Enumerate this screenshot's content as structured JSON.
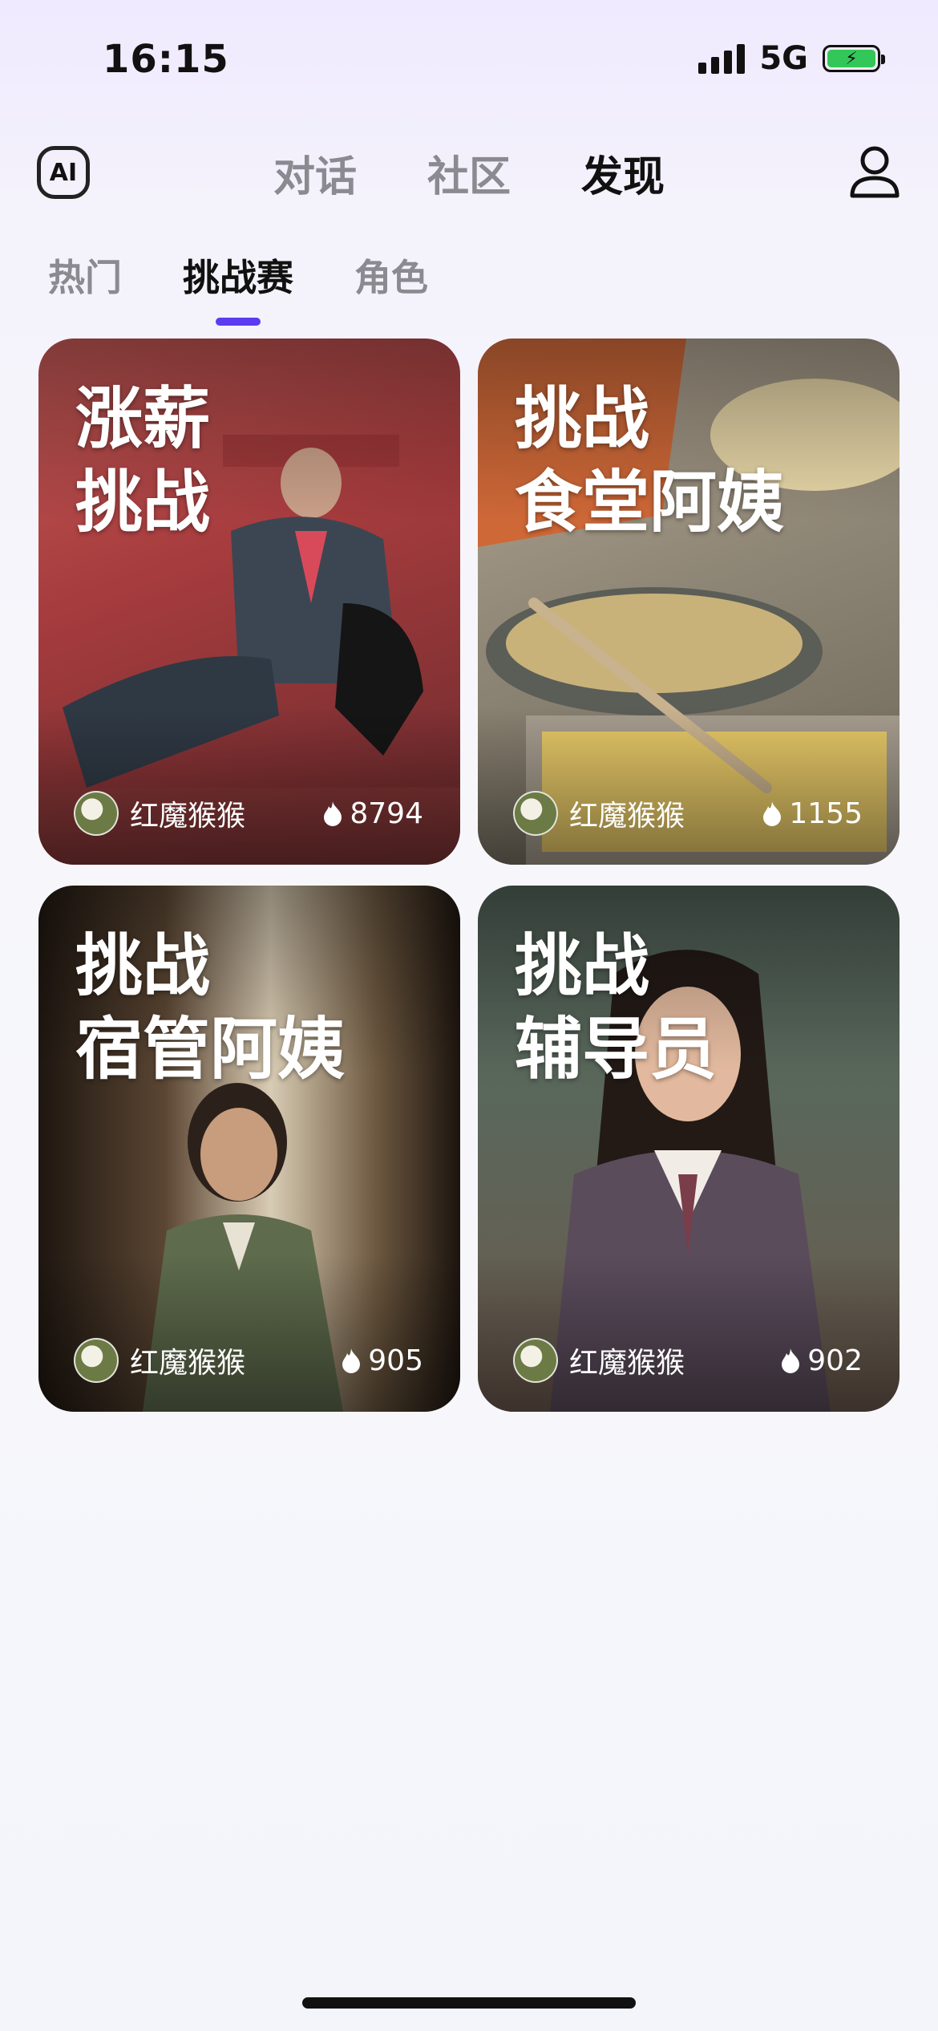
{
  "status_bar": {
    "time": "16:15",
    "network": "5G",
    "battery_icon": "battery-charging-icon"
  },
  "top_nav": {
    "logo_text": "AI",
    "tabs": [
      {
        "label": "对话",
        "active": false
      },
      {
        "label": "社区",
        "active": false
      },
      {
        "label": "发现",
        "active": true
      }
    ],
    "profile_icon": "user-icon"
  },
  "sub_tabs": [
    {
      "label": "热门",
      "active": false
    },
    {
      "label": "挑战赛",
      "active": true
    },
    {
      "label": "角色",
      "active": false
    }
  ],
  "accent_color": "#5b3cf0",
  "cards": [
    {
      "title_line1": "涨薪",
      "title_line2": "挑战",
      "author": "红魔猴猴",
      "heat": "8794",
      "image_desc_color": "#b8464a"
    },
    {
      "title_line1": "挑战",
      "title_line2": "食堂阿姨",
      "author": "红魔猴猴",
      "heat": "1155",
      "image_desc_color": "#9a8e7c"
    },
    {
      "title_line1": "挑战",
      "title_line2": "宿管阿姨",
      "author": "红魔猴猴",
      "heat": "905",
      "image_desc_color": "#4a3b2c"
    },
    {
      "title_line1": "挑战",
      "title_line2": "辅导员",
      "author": "红魔猴猴",
      "heat": "902",
      "image_desc_color": "#4b5a52"
    }
  ]
}
